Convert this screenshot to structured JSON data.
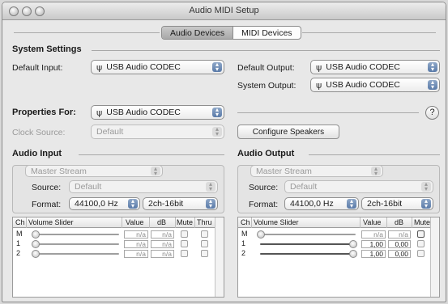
{
  "window": {
    "title": "Audio MIDI Setup"
  },
  "tabs": [
    {
      "label": "Audio Devices",
      "selected": true
    },
    {
      "label": "MIDI Devices",
      "selected": false
    }
  ],
  "system": {
    "heading": "System Settings",
    "default_input_label": "Default Input:",
    "default_input_value": "USB Audio CODEC",
    "default_output_label": "Default Output:",
    "default_output_value": "USB Audio CODEC",
    "system_output_label": "System Output:",
    "system_output_value": "USB Audio CODEC"
  },
  "properties": {
    "label": "Properties For:",
    "value": "USB Audio CODEC",
    "clock_label": "Clock Source:",
    "clock_value": "Default",
    "configure_button": "Configure Speakers",
    "help": "?"
  },
  "audio_input": {
    "heading": "Audio Input",
    "stream": "Master Stream",
    "source_label": "Source:",
    "source_value": "Default",
    "format_label": "Format:",
    "format_rate": "44100,0 Hz",
    "format_bits": "2ch-16bit",
    "columns": [
      "Ch",
      "Volume Slider",
      "Value",
      "dB",
      "Mute",
      "Thru"
    ],
    "rows": [
      {
        "ch": "M",
        "value": "n/a",
        "db": "n/a"
      },
      {
        "ch": "1",
        "value": "n/a",
        "db": "n/a"
      },
      {
        "ch": "2",
        "value": "n/a",
        "db": "n/a"
      }
    ]
  },
  "audio_output": {
    "heading": "Audio Output",
    "stream": "Master Stream",
    "source_label": "Source:",
    "source_value": "Default",
    "format_label": "Format:",
    "format_rate": "44100,0 Hz",
    "format_bits": "2ch-16bit",
    "columns": [
      "Ch",
      "Volume Slider",
      "Value",
      "dB",
      "Mute"
    ],
    "rows": [
      {
        "ch": "M",
        "value": "n/a",
        "db": "n/a",
        "level": 0
      },
      {
        "ch": "1",
        "value": "1,00",
        "db": "0,00",
        "level": 1
      },
      {
        "ch": "2",
        "value": "1,00",
        "db": "0,00",
        "level": 1
      }
    ]
  },
  "icons": {
    "usb": "usb-icon",
    "arrows": "updown-arrows-icon",
    "help": "help-icon"
  },
  "colors": {
    "window_bg": "#e8e8e8",
    "selected_tab": "#b4b4b4",
    "popup_arrows": "#6a88b4"
  }
}
